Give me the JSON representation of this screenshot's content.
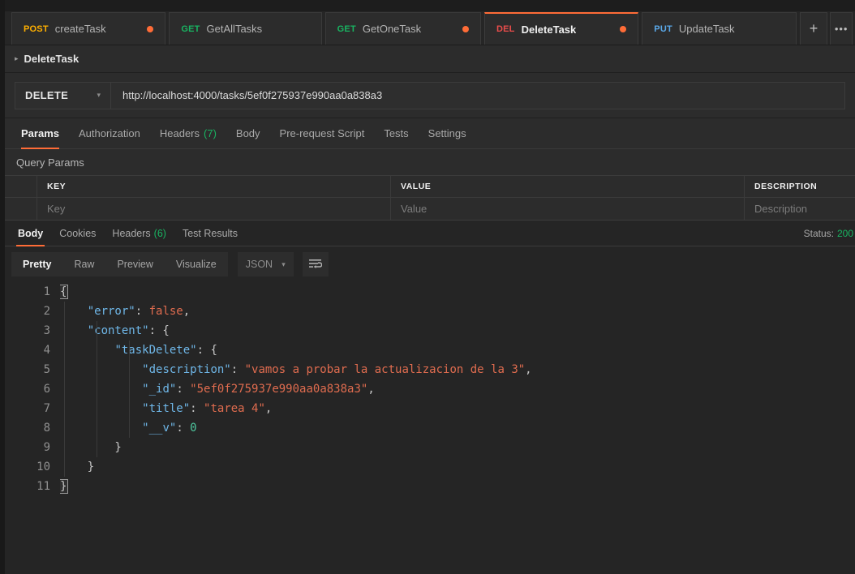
{
  "tabs": [
    {
      "method": "POST",
      "method_class": "m-post",
      "name": "createTask",
      "unsaved": true,
      "active": false
    },
    {
      "method": "GET",
      "method_class": "m-get",
      "name": "GetAllTasks",
      "unsaved": false,
      "active": false
    },
    {
      "method": "GET",
      "method_class": "m-get",
      "name": "GetOneTask",
      "unsaved": true,
      "active": false
    },
    {
      "method": "DEL",
      "method_class": "m-del",
      "name": "DeleteTask",
      "unsaved": true,
      "active": true
    },
    {
      "method": "PUT",
      "method_class": "m-put",
      "name": "UpdateTask",
      "unsaved": false,
      "active": false
    }
  ],
  "tabbar": {
    "new_tab_label": "+",
    "more_label": "•••"
  },
  "breadcrumb": {
    "caret": "▸",
    "label": "DeleteTask"
  },
  "urlbar": {
    "method": "DELETE",
    "method_caret": "▾",
    "url": "http://localhost:4000/tasks/5ef0f275937e990aa0a838a3"
  },
  "request_tabs": [
    {
      "label": "Params",
      "count": "",
      "active": true
    },
    {
      "label": "Authorization",
      "count": "",
      "active": false
    },
    {
      "label": "Headers",
      "count": "(7)",
      "active": false
    },
    {
      "label": "Body",
      "count": "",
      "active": false
    },
    {
      "label": "Pre-request Script",
      "count": "",
      "active": false
    },
    {
      "label": "Tests",
      "count": "",
      "active": false
    },
    {
      "label": "Settings",
      "count": "",
      "active": false
    }
  ],
  "query_params": {
    "title": "Query Params",
    "headers": {
      "key": "KEY",
      "value": "VALUE",
      "description": "DESCRIPTION"
    },
    "placeholders": {
      "key": "Key",
      "value": "Value",
      "description": "Description"
    }
  },
  "response_tabs": [
    {
      "label": "Body",
      "count": "",
      "active": true
    },
    {
      "label": "Cookies",
      "count": "",
      "active": false
    },
    {
      "label": "Headers",
      "count": "(6)",
      "active": false
    },
    {
      "label": "Test Results",
      "count": "",
      "active": false
    }
  ],
  "response_status": {
    "label": "Status:",
    "value": "200"
  },
  "format_bar": {
    "views": [
      {
        "label": "Pretty",
        "active": true
      },
      {
        "label": "Raw",
        "active": false
      },
      {
        "label": "Preview",
        "active": false
      },
      {
        "label": "Visualize",
        "active": false
      }
    ],
    "language": "JSON",
    "language_caret": "▾"
  },
  "response_body": {
    "line_numbers": [
      "1",
      "2",
      "3",
      "4",
      "5",
      "6",
      "7",
      "8",
      "9",
      "10",
      "11"
    ],
    "json": {
      "error": false,
      "content": {
        "taskDelete": {
          "description": "vamos a probar la actualizacion de la 3",
          "_id": "5ef0f275937e990aa0a838a3",
          "title": "tarea 4",
          "__v": 0
        }
      }
    },
    "lines": [
      "{",
      "    \"error\": false,",
      "    \"content\": {",
      "        \"taskDelete\": {",
      "            \"description\": \"vamos a probar la actualizacion de la 3\",",
      "            \"_id\": \"5ef0f275937e990aa0a838a3\",",
      "            \"title\": \"tarea 4\",",
      "            \"__v\": 0",
      "        }",
      "    }",
      "}"
    ]
  },
  "colors": {
    "accent": "#ff6c37",
    "success": "#19b361",
    "bg": "#252525",
    "panel": "#2c2c2c",
    "json_key": "#6fb7e8",
    "json_string": "#e06c4f",
    "json_number": "#4ec9a0"
  }
}
